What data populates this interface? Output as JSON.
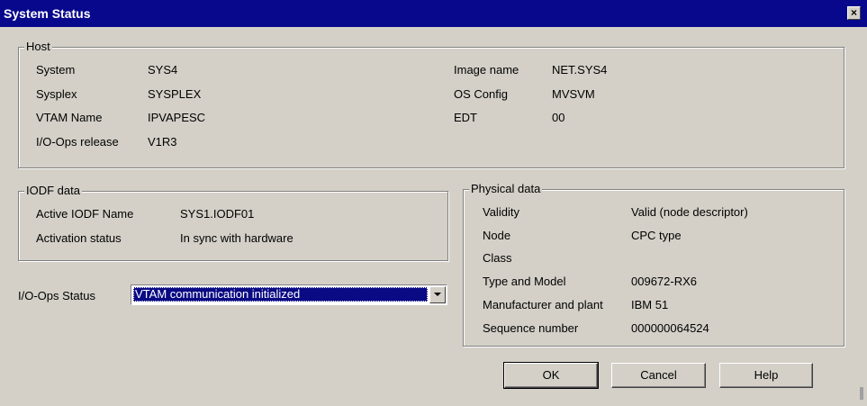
{
  "window": {
    "title": "System Status",
    "close_glyph": "×"
  },
  "host": {
    "legend": "Host",
    "left": [
      {
        "label": "System",
        "value": "SYS4"
      },
      {
        "label": "Sysplex",
        "value": "SYSPLEX"
      },
      {
        "label": "VTAM Name",
        "value": "IPVAPESC"
      },
      {
        "label": "I/O-Ops release",
        "value": "V1R3"
      }
    ],
    "right": [
      {
        "label": "Image name",
        "value": "NET.SYS4"
      },
      {
        "label": "OS Config",
        "value": "MVSVM"
      },
      {
        "label": "EDT",
        "value": "00"
      }
    ]
  },
  "iodf": {
    "legend": "IODF data",
    "rows": [
      {
        "label": "Active IODF Name",
        "value": "SYS1.IODF01"
      },
      {
        "label": "Activation status",
        "value": "In sync with hardware"
      }
    ]
  },
  "physical": {
    "legend": "Physical data",
    "rows": [
      {
        "label": "Validity",
        "value": "Valid (node descriptor)"
      },
      {
        "label": "Node",
        "value": "CPC type"
      },
      {
        "label": "Class",
        "value": ""
      },
      {
        "label": "Type and Model",
        "value": "009672-RX6"
      },
      {
        "label": "Manufacturer and plant",
        "value": "IBM 51"
      },
      {
        "label": "Sequence number",
        "value": "000000064524"
      }
    ]
  },
  "status": {
    "label": "I/O-Ops Status",
    "selected": "VTAM communication initialized"
  },
  "buttons": {
    "ok": "OK",
    "cancel": "Cancel",
    "help": "Help"
  },
  "colors": {
    "titlebar": "#08088c",
    "face": "#d4d0c8",
    "selection": "#0a0a84"
  }
}
